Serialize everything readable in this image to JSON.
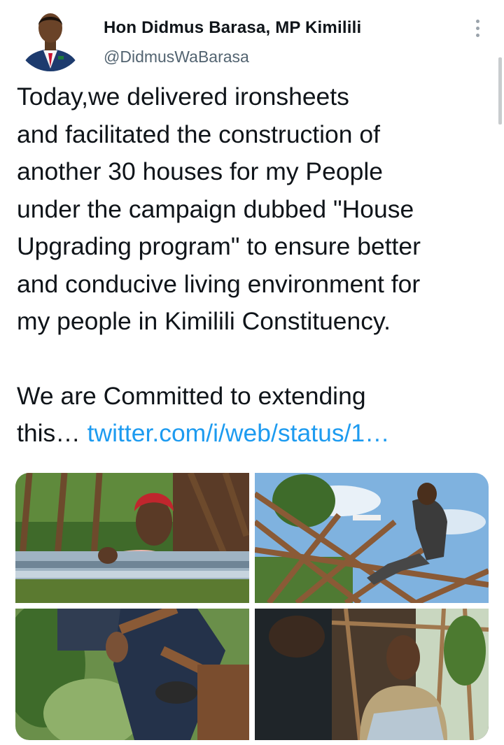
{
  "author": {
    "name": "Hon Didmus Barasa, MP Kimilili",
    "handle": "@DidmusWaBarasa",
    "avatar_icon": "profile-photo"
  },
  "tweet": {
    "lines": [
      "Today,we delivered ironsheets",
      "and facilitated the construction of",
      "another 30 houses for my People",
      "under the campaign dubbed \"House",
      "Upgrading program\" to ensure better",
      "and conducive living environment for",
      "my people in Kimilili Constituency."
    ],
    "line_2": [
      "We are Committed to extending"
    ],
    "truncated_prefix": "this… ",
    "link_text": "twitter.com/i/web/status/1…"
  },
  "menu_icon": "more-vertical-icon",
  "colors": {
    "link": "#1d9bf0",
    "secondary_text": "#536471"
  },
  "media": [
    {
      "icon": "photo-woman-carrying-iron-sheets"
    },
    {
      "icon": "photo-man-on-roof-frame"
    },
    {
      "icon": "photo-hands-with-timber"
    },
    {
      "icon": "photo-man-in-construction-site"
    }
  ]
}
